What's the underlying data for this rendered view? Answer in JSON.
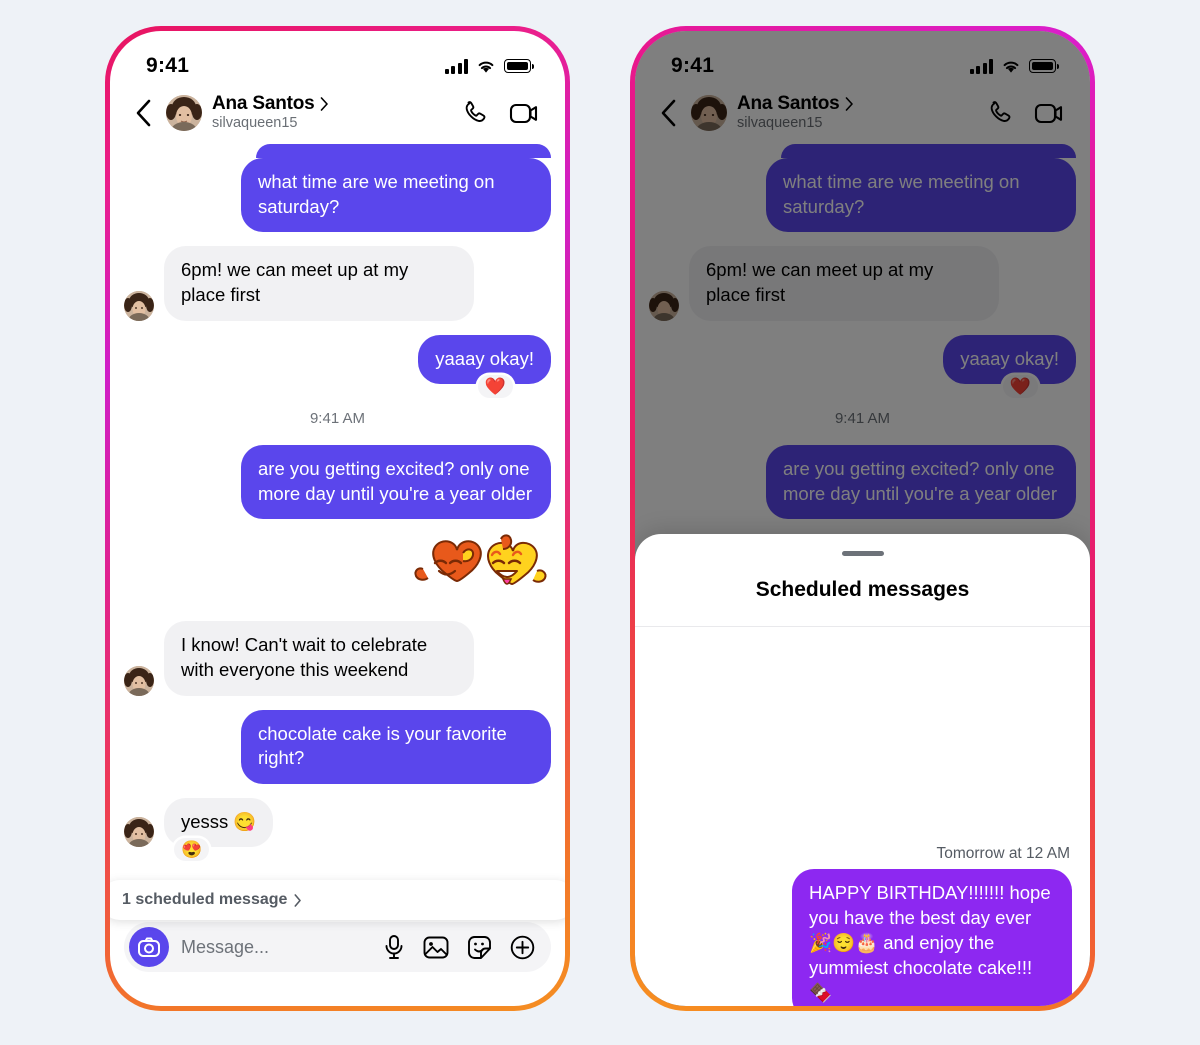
{
  "status_bar": {
    "time": "9:41",
    "signal_icon": "cellular-bars-icon",
    "wifi_icon": "wifi-icon",
    "battery_icon": "battery-full-icon"
  },
  "chat_header": {
    "back_icon": "back-chevron-icon",
    "avatar": "contact-avatar",
    "name": "Ana Santos",
    "name_chevron_icon": "chevron-right-icon",
    "handle": "silvaqueen15",
    "call_icon": "phone-call-icon",
    "video_icon": "video-call-icon"
  },
  "messages": [
    {
      "id": "m1",
      "side": "out",
      "text": "what time are we meeting on saturday?"
    },
    {
      "id": "m2",
      "side": "in",
      "text": "6pm! we can meet up at my place first"
    },
    {
      "id": "m3",
      "side": "out",
      "text": "yaaay okay!",
      "reaction": "❤️"
    },
    {
      "id": "m4",
      "side": "out",
      "text": "are you getting excited? only one more day until you're a year older"
    },
    {
      "id": "m5",
      "side": "out",
      "type": "sticker",
      "sticker_name": "two-laughing-hearts-sticker"
    },
    {
      "id": "m6",
      "side": "in",
      "text": "I know! Can't wait to celebrate with everyone this weekend"
    },
    {
      "id": "m7",
      "side": "out",
      "text": "chocolate cake is your favorite right?"
    },
    {
      "id": "m8",
      "side": "in",
      "text": "yesss 😋",
      "reaction": "😍"
    }
  ],
  "thread_timestamp": "9:41 AM",
  "scheduled_banner": {
    "label": "1 scheduled message",
    "chevron_icon": "chevron-right-icon"
  },
  "composer": {
    "camera_icon": "camera-icon",
    "placeholder": "Message...",
    "icons": [
      "microphone-icon",
      "photo-icon",
      "sticker-icon",
      "plus-circle-icon"
    ]
  },
  "sheet": {
    "grabber": "sheet-grabber",
    "title": "Scheduled messages",
    "scheduled_time": "Tomorrow at 12 AM",
    "scheduled_text": "HAPPY BIRTHDAY!!!!!!! hope you have the best day ever 🎉😌🎂 and enjoy the yummiest chocolate cake!!!🍫"
  },
  "colors": {
    "outgoing_bubble": "#5a46ec",
    "incoming_bubble": "#f1f1f3",
    "scheduled_bubble": "#8d28f1",
    "page_background": "#eef2f7",
    "frame_gradient_start": "#e8145f",
    "frame_gradient_end": "#f58f22"
  }
}
